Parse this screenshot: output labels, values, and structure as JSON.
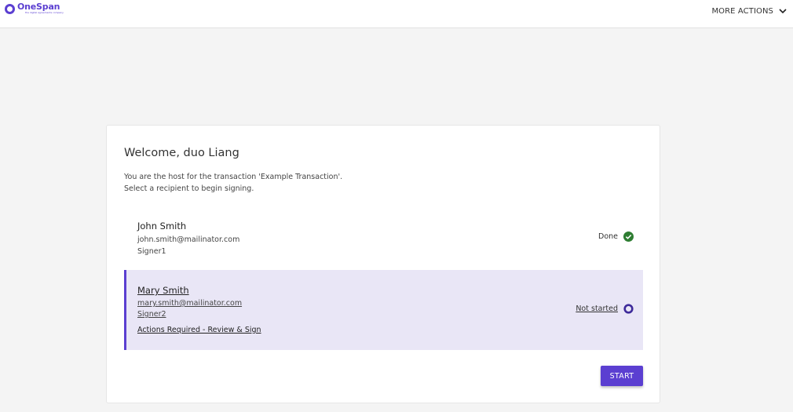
{
  "header": {
    "logo_name": "OneSpan",
    "logo_tagline": "the digital agreements company",
    "more_actions_label": "MORE ACTIONS",
    "chevron_icon": "chevron-down-icon"
  },
  "card": {
    "welcome": "Welcome, duo Liang",
    "intro_line1": "You are the host for the transaction 'Example Transaction'.",
    "intro_line2": "Select a recipient to begin signing.",
    "recipients": [
      {
        "name": "John Smith",
        "email": "john.smith@mailinator.com",
        "role": "Signer1",
        "status": "Done",
        "status_icon": "check-circle-icon"
      },
      {
        "name": "Mary Smith",
        "email": "mary.smith@mailinator.com",
        "role": "Signer2",
        "actions": "Actions Required - Review & Sign",
        "status": "Not started",
        "status_icon": "empty-circle-icon"
      }
    ],
    "start_label": "START"
  },
  "colors": {
    "brand": "#5b3fd1",
    "done_green": "#2e7d32",
    "selected_bg": "#e9e6f6"
  }
}
